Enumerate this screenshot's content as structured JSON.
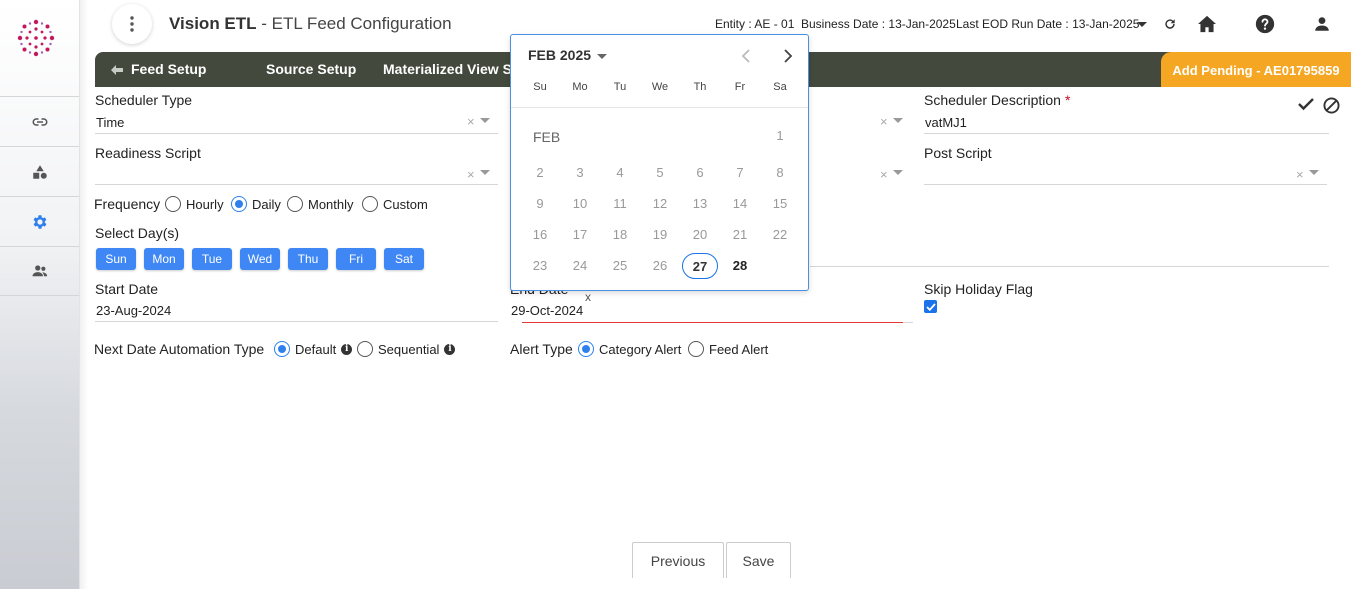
{
  "header": {
    "app_name": "Vision ETL",
    "page_title": "- ETL Feed Configuration",
    "entity_label": "Entity :",
    "entity_value": "AE - 01",
    "business_date_label": "Business Date :",
    "business_date_value": "13-Jan-2025",
    "eod_label": "Last EOD Run Date :",
    "eod_value": "13-Jan-2025"
  },
  "nav": {
    "tabs": [
      "Feed Setup",
      "Source Setup",
      "Materialized View Se"
    ],
    "pending_label": "Add Pending - AE01795859"
  },
  "form": {
    "scheduler_type": {
      "label": "Scheduler Type",
      "value": "Time"
    },
    "readiness_script": {
      "label": "Readiness Script",
      "value": ""
    },
    "scheduler_description": {
      "label": "Scheduler Description",
      "required_mark": "*",
      "value": "vatMJ1"
    },
    "post_script": {
      "label": "Post Script",
      "value": ""
    },
    "clear_glyph": "×",
    "frequency": {
      "label": "Frequency",
      "options": [
        "Hourly",
        "Daily",
        "Monthly",
        "Custom"
      ],
      "selected": "Daily"
    },
    "select_days": {
      "label": "Select Day(s)",
      "days": [
        "Sun",
        "Mon",
        "Tue",
        "Wed",
        "Thu",
        "Fri",
        "Sat"
      ]
    },
    "start_date": {
      "label": "Start Date",
      "value": "23-Aug-2024"
    },
    "end_date": {
      "label": "End Date",
      "value": "29-Oct-2024",
      "clear": "x"
    },
    "skip_holiday": {
      "label": "Skip Holiday Flag",
      "checked": true
    },
    "next_date_automation": {
      "label": "Next Date Automation Type",
      "options": [
        "Default",
        "Sequential"
      ],
      "selected": "Default",
      "info_glyph": "i"
    },
    "alert_type": {
      "label": "Alert Type",
      "options": [
        "Category Alert",
        "Feed Alert"
      ],
      "selected": "Category Alert"
    }
  },
  "calendar": {
    "month_year": "FEB 2025",
    "month_short": "FEB",
    "weekdays": [
      "Su",
      "Mo",
      "Tu",
      "We",
      "Th",
      "Fr",
      "Sa"
    ],
    "rows": [
      [
        "",
        "",
        "",
        "",
        "",
        "",
        "1"
      ],
      [
        "2",
        "3",
        "4",
        "5",
        "6",
        "7",
        "8"
      ],
      [
        "9",
        "10",
        "11",
        "12",
        "13",
        "14",
        "15"
      ],
      [
        "16",
        "17",
        "18",
        "19",
        "20",
        "21",
        "22"
      ],
      [
        "23",
        "24",
        "25",
        "26",
        "27",
        "28",
        ""
      ]
    ],
    "today": "27",
    "emphasized": "28"
  },
  "footer": {
    "previous_label": "Previous",
    "save_label": "Save"
  },
  "colors": {
    "navbar": "#434a3d",
    "pending": "#f5a623",
    "accent": "#3f87f5"
  }
}
